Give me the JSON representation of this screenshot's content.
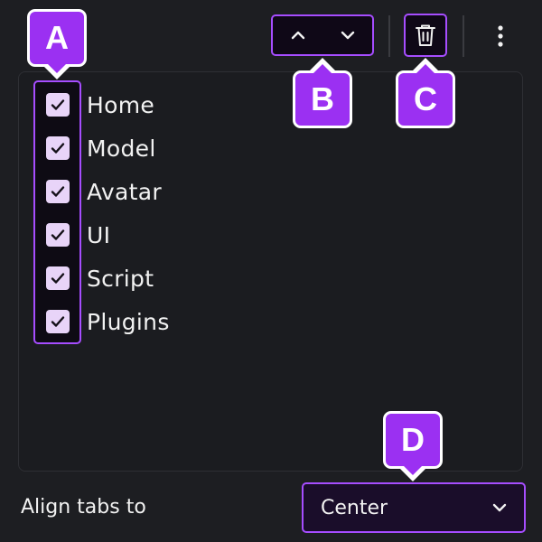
{
  "toolbar": {
    "move_up_icon": "chevron-up-icon",
    "move_down_icon": "chevron-down-icon",
    "delete_icon": "trash-icon",
    "more_icon": "more-vertical-icon"
  },
  "tabs": [
    {
      "label": "Home",
      "checked": true
    },
    {
      "label": "Model",
      "checked": true
    },
    {
      "label": "Avatar",
      "checked": true
    },
    {
      "label": "UI",
      "checked": true
    },
    {
      "label": "Script",
      "checked": true
    },
    {
      "label": "Plugins",
      "checked": true
    }
  ],
  "align": {
    "label": "Align tabs to",
    "value": "Center"
  },
  "callouts": {
    "a": "A",
    "b": "B",
    "c": "C",
    "d": "D"
  },
  "colors": {
    "accent": "#a64dff",
    "badge": "#9b30f2",
    "background": "#1d1e22",
    "checkbox": "#e8d4f8"
  }
}
